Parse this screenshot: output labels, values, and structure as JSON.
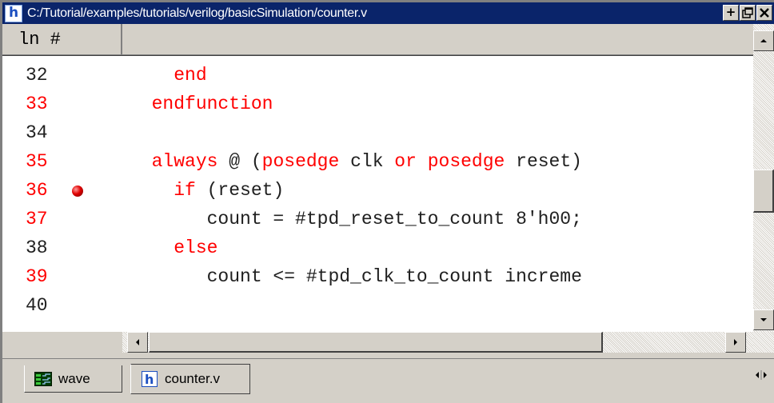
{
  "window": {
    "title": "C:/Tutorial/examples/tutorials/verilog/basicSimulation/counter.v",
    "app_icon_letter": "h",
    "buttons": {
      "dock": "+",
      "undock": "⧉",
      "close": "✕"
    }
  },
  "header": {
    "line_number_label": "ln #"
  },
  "code_lines": [
    {
      "num": "32",
      "num_color": "black",
      "tokens": [
        {
          "text": "    ",
          "c": "blk"
        },
        {
          "text": "end",
          "c": "red"
        }
      ]
    },
    {
      "num": "33",
      "num_color": "red",
      "tokens": [
        {
          "text": "  ",
          "c": "blk"
        },
        {
          "text": "endfunction",
          "c": "red"
        }
      ]
    },
    {
      "num": "34",
      "num_color": "black",
      "tokens": []
    },
    {
      "num": "35",
      "num_color": "red",
      "tokens": [
        {
          "text": "  ",
          "c": "blk"
        },
        {
          "text": "always",
          "c": "red"
        },
        {
          "text": " @ (",
          "c": "blk"
        },
        {
          "text": "posedge",
          "c": "red"
        },
        {
          "text": " clk ",
          "c": "blk"
        },
        {
          "text": "or",
          "c": "red"
        },
        {
          "text": " ",
          "c": "blk"
        },
        {
          "text": "posedge",
          "c": "red"
        },
        {
          "text": " reset)",
          "c": "blk"
        }
      ]
    },
    {
      "num": "36",
      "num_color": "red",
      "breakpoint": true,
      "tokens": [
        {
          "text": "    ",
          "c": "blk"
        },
        {
          "text": "if",
          "c": "red"
        },
        {
          "text": " (reset)",
          "c": "blk"
        }
      ]
    },
    {
      "num": "37",
      "num_color": "red",
      "tokens": [
        {
          "text": "       count = #tpd_reset_to_count 8'h00;",
          "c": "blk"
        }
      ]
    },
    {
      "num": "38",
      "num_color": "black",
      "tokens": [
        {
          "text": "    ",
          "c": "blk"
        },
        {
          "text": "else",
          "c": "red"
        }
      ]
    },
    {
      "num": "39",
      "num_color": "red",
      "tokens": [
        {
          "text": "       count <= #tpd_clk_to_count increme",
          "c": "blk"
        }
      ]
    },
    {
      "num": "40",
      "num_color": "black",
      "tokens": []
    }
  ],
  "scroll": {
    "vertical_position": 0.55,
    "horizontal_position": 0.0
  },
  "tabs": [
    {
      "label": "wave",
      "icon": "wave-window-icon",
      "active": false
    },
    {
      "label": "counter.v",
      "icon": "source-file-icon",
      "active": true
    }
  ],
  "colors": {
    "titlebar": "#0a246a",
    "keyword": "#ff0000",
    "text": "#202020",
    "chrome": "#d4d0c8"
  }
}
